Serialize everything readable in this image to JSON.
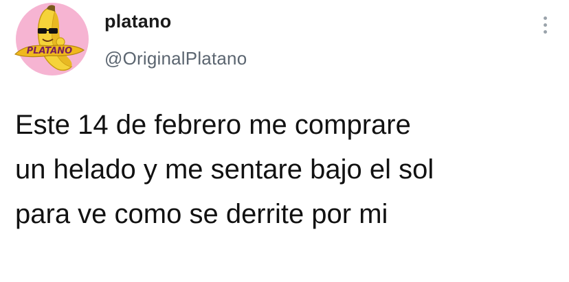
{
  "tweet": {
    "author": {
      "display_name": "platano",
      "handle": "@OriginalPlatano",
      "avatar": {
        "icon": "banana-mascot-avatar",
        "logo_text": "PLATANO",
        "background_color": "#f6b4d2",
        "banana_color": "#f5d33a",
        "logo_color": "#f0b81e"
      }
    },
    "menu_icon": "more-vertical-icon",
    "text_lines": [
      "Este 14 de febrero me comprare",
      "un helado y me sentare bajo el sol",
      "para ve como se derrite por mi"
    ]
  }
}
